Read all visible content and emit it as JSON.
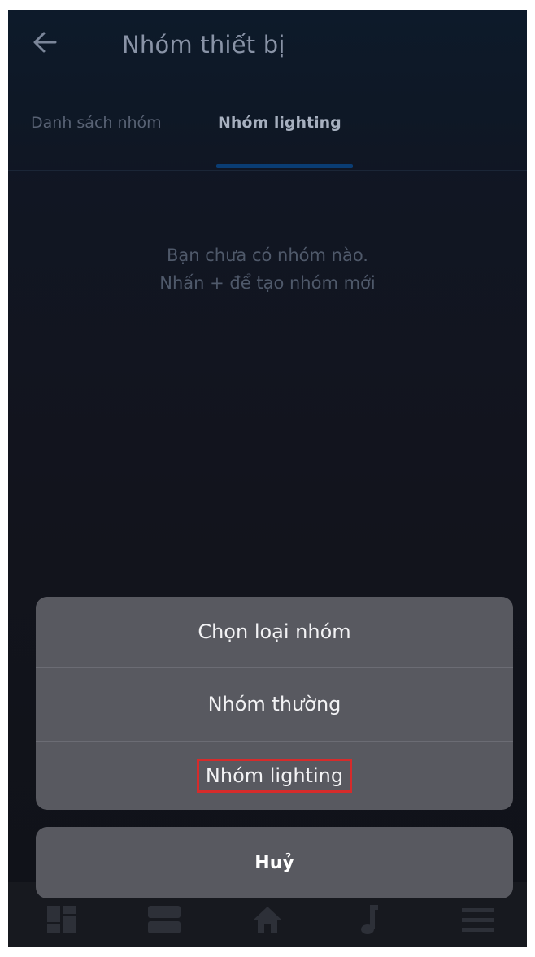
{
  "header": {
    "title": "Nhóm thiết bị",
    "back_icon": "arrow-left-icon"
  },
  "tabs": [
    {
      "label": "Danh sách nhóm",
      "active": false
    },
    {
      "label": "Nhóm lighting",
      "active": true
    }
  ],
  "empty_state": {
    "line1": "Bạn chưa có nhóm nào.",
    "line2": "Nhấn + để tạo nhóm mới"
  },
  "action_sheet": {
    "title": "Chọn loại nhóm",
    "options": [
      {
        "label": "Nhóm thường"
      },
      {
        "label": "Nhóm lighting",
        "highlighted": true
      }
    ],
    "cancel_label": "Huỷ"
  },
  "bottom_nav": [
    {
      "icon": "dashboard-icon"
    },
    {
      "icon": "rooms-icon"
    },
    {
      "icon": "home-icon"
    },
    {
      "icon": "music-note-icon"
    },
    {
      "icon": "menu-icon"
    }
  ],
  "colors": {
    "background": "#12141d",
    "sheet": "#585960",
    "accent_underline": "#0a3d74",
    "highlight_box": "#d62b2b"
  }
}
